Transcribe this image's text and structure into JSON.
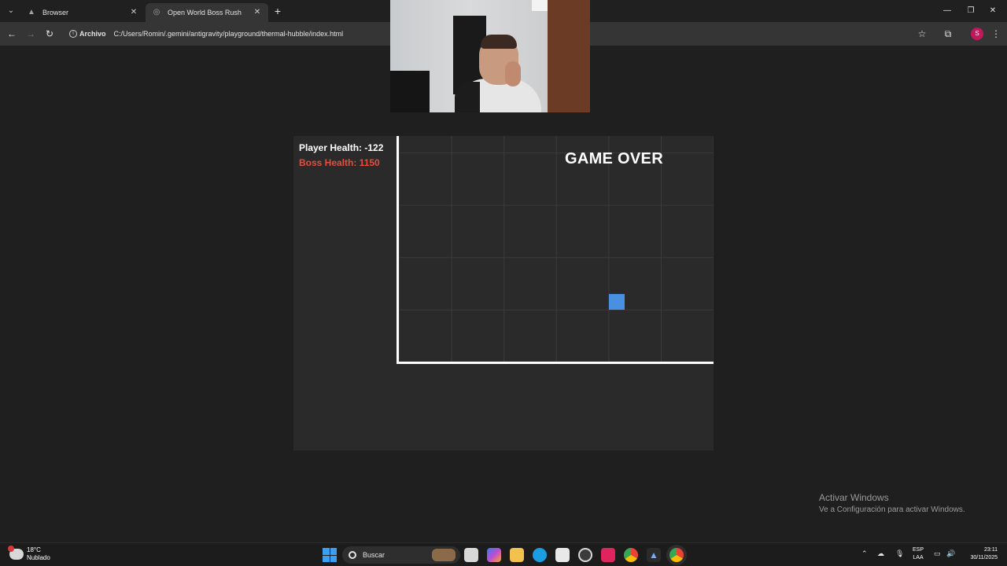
{
  "tabs": {
    "menu_icon": "chevron-down",
    "inactive": {
      "title": "Browser"
    },
    "active": {
      "title": "Open World Boss Rush"
    },
    "new_tab": "+"
  },
  "toolbar": {
    "chip": "Archivo",
    "url": "C:/Users/Romin/.gemini/antigravity/playground/thermal-hubble/index.html",
    "profile_initial": "S"
  },
  "game": {
    "player_health": "Player Health: -122",
    "boss_health": "Boss Health: 1150",
    "status": "GAME OVER",
    "colors": {
      "player": "#4a90e2",
      "boss_text": "#e74c3c",
      "background": "#2a2a2a"
    }
  },
  "watermark": {
    "line1": "Activar Windows",
    "line2": "Ve a Configuración para activar Windows."
  },
  "taskbar": {
    "weather_temp": "18°C",
    "weather_cond": "Nublado",
    "search_placeholder": "Buscar",
    "lang_line1": "ESP",
    "lang_line2": "LAA",
    "time": "23:11",
    "date": "30/11/2025"
  }
}
